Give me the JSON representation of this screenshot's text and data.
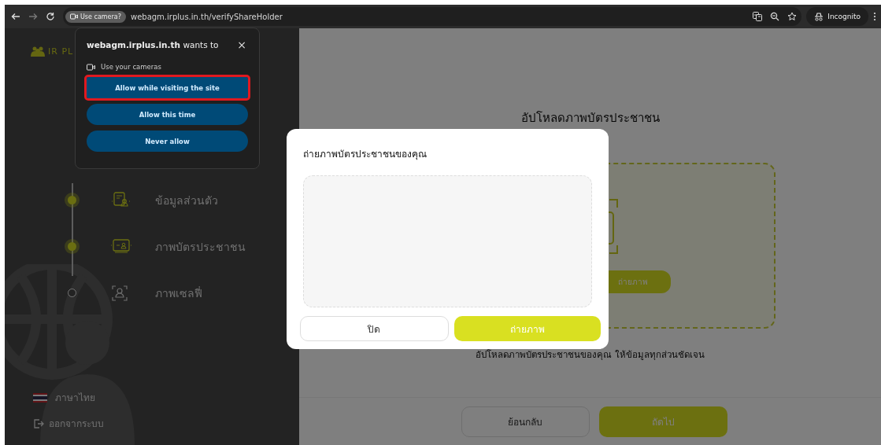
{
  "browser": {
    "permission_chip": "Use camera?",
    "url": "webagm.irplus.in.th/verifyShareHolder",
    "profile_chip": "Incognito"
  },
  "permission_popup": {
    "title": "**webagm.irplus.in.th** wants to",
    "close": "×",
    "permission": "Use your cameras",
    "buttons": [
      {
        "label": "Allow while visiting the site",
        "highlighted": true
      },
      {
        "label": "Allow this time",
        "highlighted": false
      },
      {
        "label": "Never allow",
        "highlighted": false
      }
    ]
  },
  "sidebar": {
    "logo_text": "IR PL",
    "steps": [
      {
        "label": "ข้อมูลส่วนตัว",
        "kind": "profile",
        "completed": true
      },
      {
        "label": "ภาพบัตรประชาชน",
        "kind": "idcard",
        "completed": true
      },
      {
        "label": "ภาพเซลฟี่",
        "kind": "selfie",
        "completed": false
      }
    ],
    "language": "ภาษาไทย",
    "logout": "ออกจากระบบ"
  },
  "main": {
    "title": "อัปโหลดภาพบัตรประชาชน",
    "upload_button": "ถ่ายภาพ",
    "caption": "อัปโหลดภาพบัตรประชาชนของคุณ ให้ข้อมูลทุกส่วนชัดเจน",
    "footer_buttons": [
      {
        "label": "ย้อนกลับ",
        "kind": "secondary"
      },
      {
        "label": "ถัดไป",
        "kind": "primary"
      }
    ]
  },
  "modal": {
    "title": "ถ่ายภาพบัตรประชาชนของคุณ",
    "buttons": [
      {
        "label": "ปิด",
        "kind": "secondary"
      },
      {
        "label": "ถ่ายภาพ",
        "kind": "primary"
      }
    ]
  }
}
